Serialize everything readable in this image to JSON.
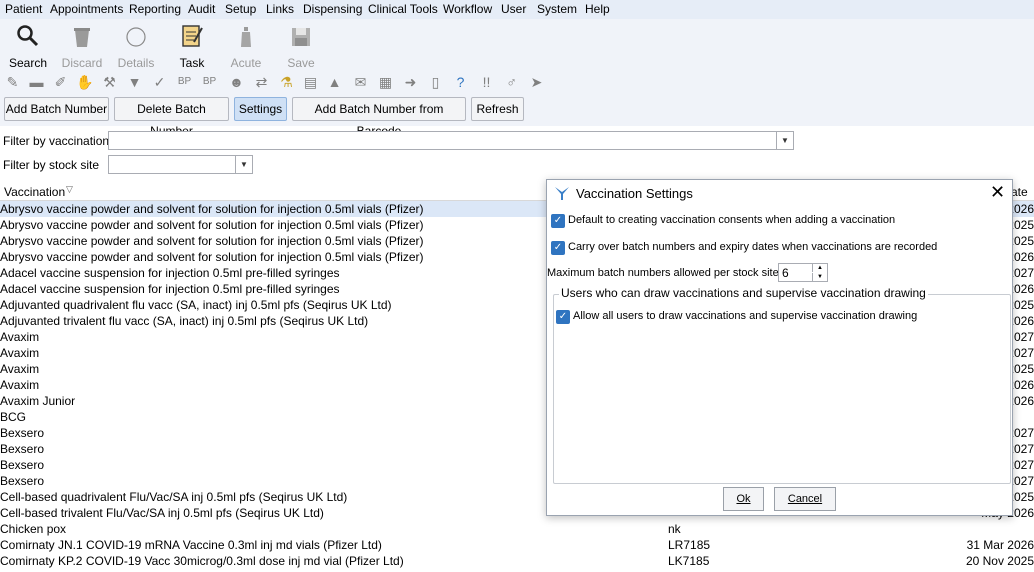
{
  "menu": [
    "Patient",
    "Appointments",
    "Reporting",
    "Audit",
    "Setup",
    "Links",
    "Dispensing",
    "Clinical Tools",
    "Workflow",
    "User",
    "System",
    "Help"
  ],
  "toolbar": {
    "buttons": [
      {
        "label": "Search",
        "icon": "search-icon"
      },
      {
        "label": "Discard",
        "icon": "discard-icon"
      },
      {
        "label": "Details",
        "icon": "details-icon"
      },
      {
        "label": "Task",
        "icon": "task-icon"
      },
      {
        "label": "Acute",
        "icon": "acute-icon"
      },
      {
        "label": "Save",
        "icon": "save-icon"
      }
    ],
    "icon_row_text": {
      "bp1": "BP",
      "bp2": "BP"
    }
  },
  "actions": {
    "add_batch": "Add Batch Number",
    "delete_batch": "Delete Batch Number",
    "settings": "Settings",
    "add_from_barcode": "Add Batch Number from Barcode",
    "refresh": "Refresh"
  },
  "filters": {
    "vaccination_label": "Filter by vaccination",
    "vaccination_value": "",
    "stock_site_label": "Filter by stock site",
    "stock_site_value": ""
  },
  "grid": {
    "col_vaccination": "Vaccination",
    "col_date_fragment": "ate",
    "rows": [
      {
        "name": "Abrysvo vaccine powder and solvent for solution for injection 0.5ml vials (Pfizer)",
        "batch": "",
        "date": "2026"
      },
      {
        "name": "Abrysvo vaccine powder and solvent for solution for injection 0.5ml vials (Pfizer)",
        "batch": "",
        "date": "2025"
      },
      {
        "name": "Abrysvo vaccine powder and solvent for solution for injection 0.5ml vials (Pfizer)",
        "batch": "",
        "date": "2025"
      },
      {
        "name": "Abrysvo vaccine powder and solvent for solution for injection 0.5ml vials (Pfizer)",
        "batch": "",
        "date": "2026"
      },
      {
        "name": "Adacel vaccine suspension for injection 0.5ml pre-filled syringes",
        "batch": "",
        "date": "2027"
      },
      {
        "name": "Adacel vaccine suspension for injection 0.5ml pre-filled syringes",
        "batch": "",
        "date": "2026"
      },
      {
        "name": "Adjuvanted quadrivalent flu vacc (SA, inact) inj 0.5ml pfs (Seqirus UK Ltd)",
        "batch": "",
        "date": "2025"
      },
      {
        "name": "Adjuvanted trivalent flu vacc (SA, inact) inj 0.5ml pfs (Seqirus UK Ltd)",
        "batch": "",
        "date": "2026"
      },
      {
        "name": "Avaxim",
        "batch": "",
        "date": "027"
      },
      {
        "name": "Avaxim",
        "batch": "",
        "date": "2027"
      },
      {
        "name": "Avaxim",
        "batch": "",
        "date": "2025"
      },
      {
        "name": "Avaxim",
        "batch": "",
        "date": "2026"
      },
      {
        "name": "Avaxim Junior",
        "batch": "",
        "date": "2026"
      },
      {
        "name": "BCG",
        "batch": "",
        "date": ""
      },
      {
        "name": "Bexsero",
        "batch": "",
        "date": "2027"
      },
      {
        "name": "Bexsero",
        "batch": "",
        "date": "2027"
      },
      {
        "name": "Bexsero",
        "batch": "",
        "date": "2027"
      },
      {
        "name": "Bexsero",
        "batch": "",
        "date": "2027"
      },
      {
        "name": "Cell-based quadrivalent Flu/Vac/SA inj 0.5ml pfs (Seqirus UK Ltd)",
        "batch": "",
        "date": "2025"
      },
      {
        "name": "Cell-based trivalent Flu/Vac/SA inj 0.5ml pfs (Seqirus UK Ltd)",
        "batch": "",
        "date": "May 2026"
      },
      {
        "name": "Chicken pox",
        "batch": "nk",
        "date": ""
      },
      {
        "name": "Comirnaty JN.1 COVID-19 mRNA Vaccine 0.3ml inj md vials (Pfizer Ltd)",
        "batch": "LR7185",
        "date": "31 Mar 2026"
      },
      {
        "name": "Comirnaty KP.2 COVID-19 Vacc 30microg/0.3ml dose inj md vial (Pfizer Ltd)",
        "batch": "LK7185",
        "date": "20 Nov 2025"
      }
    ]
  },
  "dialog": {
    "title": "Vaccination Settings",
    "opt_default_consents": "Default to creating vaccination consents when adding a vaccination",
    "opt_default_consents_checked": true,
    "opt_carry_over": "Carry over batch numbers and expiry dates when vaccinations are recorded",
    "opt_carry_over_checked": true,
    "max_batch_label": "Maximum batch numbers allowed per stock site",
    "max_batch_value": "6",
    "group_title": "Users who can draw vaccinations and supervise vaccination drawing",
    "opt_allow_all": "Allow all users to draw vaccinations and supervise vaccination drawing",
    "opt_allow_all_checked": true,
    "ok": "Ok",
    "cancel": "Cancel"
  },
  "colors": {
    "accent": "#2f74c0",
    "selected_row": "#dbe7f7",
    "menubar": "#e6edf7"
  }
}
